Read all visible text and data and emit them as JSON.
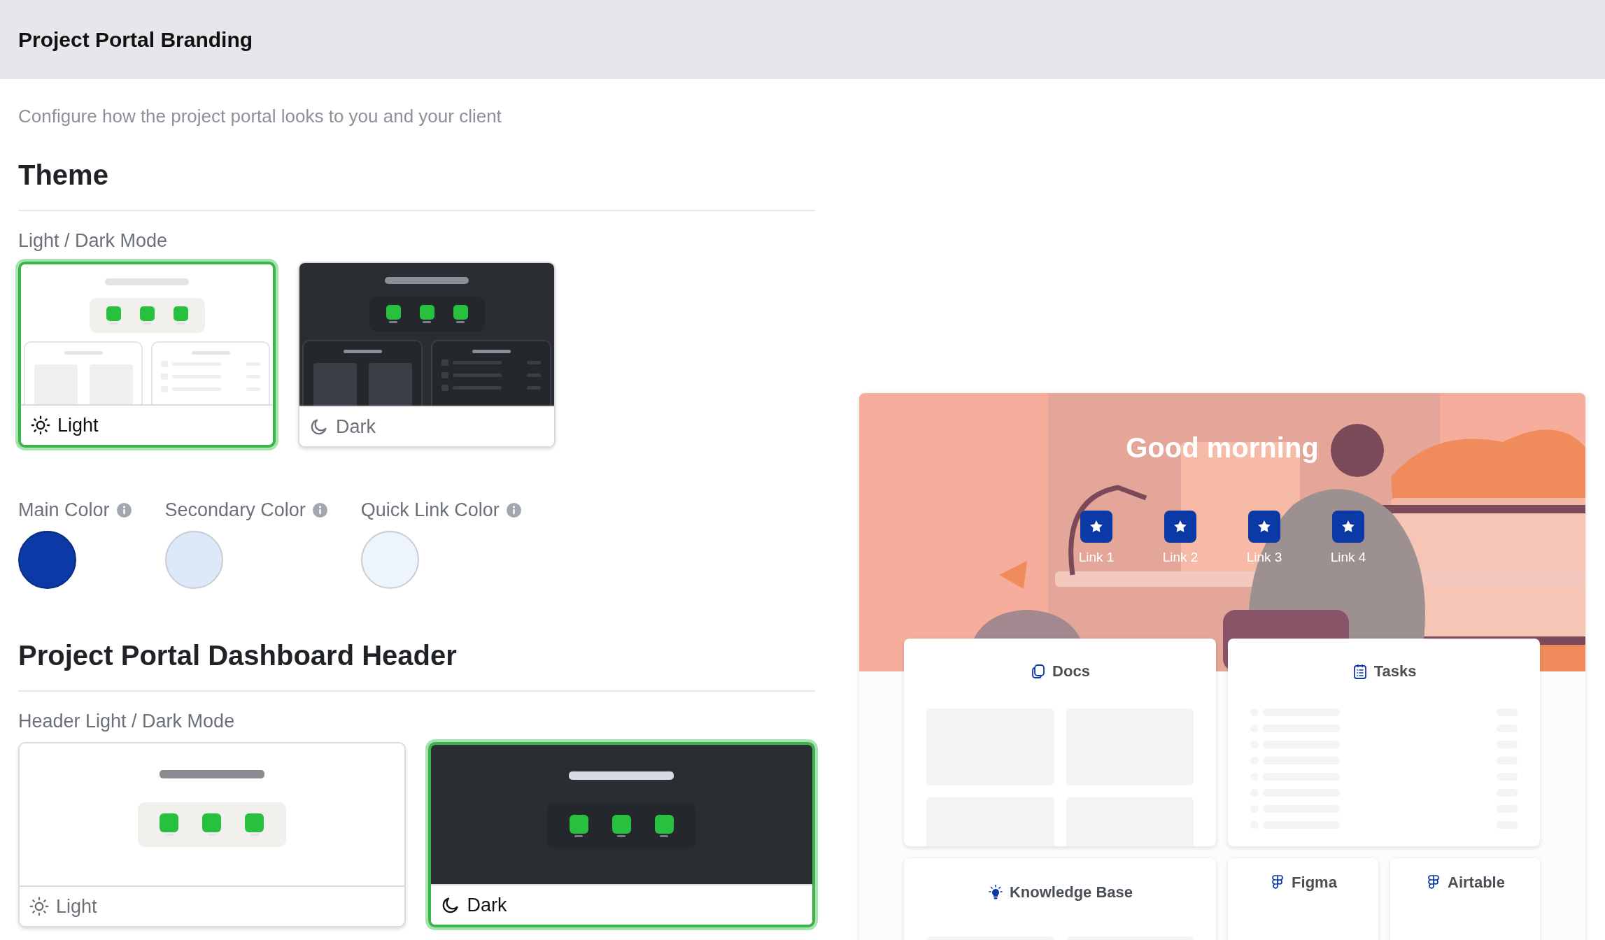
{
  "header": {
    "title": "Project Portal Branding"
  },
  "subtitle": "Configure how the project portal looks to you and your client",
  "theme": {
    "heading": "Theme",
    "mode_label": "Light / Dark Mode",
    "modes": [
      {
        "label": "Light",
        "kind": "light",
        "selected": true
      },
      {
        "label": "Dark",
        "kind": "dark",
        "selected": false
      }
    ]
  },
  "colors": [
    {
      "label": "Main Color",
      "color": "#0b3aa6"
    },
    {
      "label": "Secondary Color",
      "color": "#dde9fa"
    },
    {
      "label": "Quick Link Color",
      "color": "#eef4fc"
    }
  ],
  "dashboard_header": {
    "heading": "Project Portal Dashboard Header",
    "mode_label": "Header Light / Dark Mode",
    "modes": [
      {
        "label": "Light",
        "kind": "light",
        "selected": false
      },
      {
        "label": "Dark",
        "kind": "dark",
        "selected": true
      }
    ]
  },
  "preview": {
    "greeting": "Good morning",
    "quick_links": [
      {
        "label": "Link 1"
      },
      {
        "label": "Link 2"
      },
      {
        "label": "Link 3"
      },
      {
        "label": "Link 4"
      }
    ],
    "cards": [
      {
        "title": "Docs",
        "kind": "grid"
      },
      {
        "title": "Tasks",
        "kind": "list"
      },
      {
        "title": "Knowledge Base",
        "kind": "grid"
      },
      {
        "title": "Figma",
        "kind": "empty"
      },
      {
        "title": "Airtable",
        "kind": "empty"
      }
    ]
  }
}
